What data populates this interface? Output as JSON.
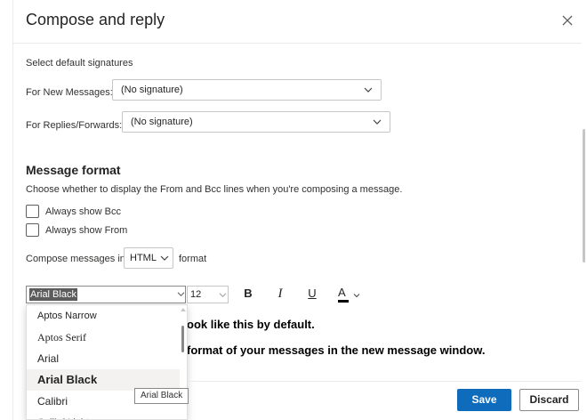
{
  "dialog": {
    "title": "Compose and reply"
  },
  "signatures": {
    "heading": "Select default signatures",
    "new_messages_label": "For New Messages:",
    "new_messages_value": "(No signature)",
    "replies_label": "For Replies/Forwards:",
    "replies_value": "(No signature)"
  },
  "message_format": {
    "title": "Message format",
    "description": "Choose whether to display the From and Bcc lines when you're composing a message.",
    "always_show_bcc": "Always show Bcc",
    "always_show_from": "Always show From",
    "compose_in_label": "Compose messages in",
    "format_value": "HTML",
    "format_suffix": "format"
  },
  "toolbar": {
    "font_value": "Arial Black",
    "size_value": "12",
    "bold": "B",
    "italic": "I",
    "underline": "U",
    "font_color": "A"
  },
  "preview": {
    "line1": "ook like this by default.",
    "line2": "format of your messages in the new message window."
  },
  "font_dropdown": {
    "options": [
      "Aptos Narrow",
      "Aptos Serif",
      "Arial",
      "Arial Black",
      "Calibri",
      "Calibri Light"
    ],
    "selected": "Arial Black"
  },
  "tooltip": "Arial Black",
  "footer": {
    "save": "Save",
    "discard": "Discard"
  },
  "colors": {
    "accent": "#0f6cbd",
    "text": "#242424",
    "border": "#c8c6c4"
  }
}
